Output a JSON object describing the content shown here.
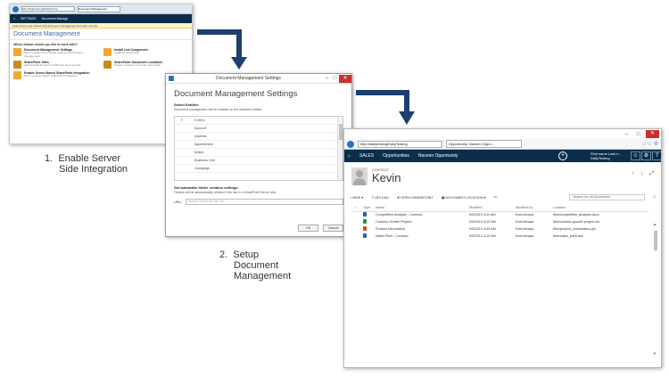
{
  "colors": {
    "arrow": "#1c3f6e",
    "crm_nav": "#0a2e4c",
    "close_red": "#c7302c",
    "title_blue": "#3a6ea5"
  },
  "captions": {
    "step1": {
      "number": "1.",
      "line1": "Enable Server",
      "line2": "Side Integration"
    },
    "step2": {
      "number": "2.",
      "line1": "Setup",
      "line2": "Document",
      "line3": "Management"
    }
  },
  "shot1": {
    "address": "http://dailytesting/DailyTesting",
    "tab": "Document Management",
    "nav": [
      "SETTINGS",
      "Document Manage"
    ],
    "notice": "Learn how to get started with document management and store records...",
    "title": "Document Management",
    "question": "Which feature would you like to work with?",
    "options": [
      {
        "title": "Document Management Settings",
        "desc": "Select entities and manage settings for document management."
      },
      {
        "title": "Install List Component",
        "desc": "Install list component"
      },
      {
        "title": "SharePoint Sites",
        "desc": "Add SharePoint sites to CRM and store records."
      },
      {
        "title": "SharePoint Document Locations",
        "desc": "Create a location record for each folder."
      },
      {
        "title": "Enable Server-Based SharePoint Integration",
        "desc": "Move to server-based SharePoint integration."
      }
    ]
  },
  "shot2": {
    "window_title": "Document Management Settings",
    "heading": "Document Management Settings",
    "select_label": "Select Entities",
    "select_desc": "Document management will be enabled on the selected entities.",
    "entities": [
      "Entities",
      "Account",
      "Address",
      "Appointment",
      "Article",
      "Business Unit",
      "Campaign"
    ],
    "folder_label": "Set automatic folder creation settings",
    "folder_desc": "Folders will be automatically created if the site is a SharePoint Server site.",
    "url_label": "URL:",
    "url_placeholder": "Specify SharePoint Site URL",
    "ok": "OK",
    "cancel": "Cancel"
  },
  "shot3": {
    "address": "http://dailytesting/DailyTesting",
    "tab": "Opportunity: Naveen Oppo...",
    "nav": [
      "SALES",
      "Opportunities",
      "Naveen Opportunity"
    ],
    "user": [
      "First name Last n...",
      "DailyTesting"
    ],
    "contact_type": "CONTACT",
    "contact_name": "Kevin",
    "commands": [
      "NEW",
      "UPLOAD",
      "OPEN SHAREPOINT",
      "DOCUMENT LOCATION",
      "•••"
    ],
    "search_placeholder": "Search for all documents",
    "columns": [
      "Type",
      "Name",
      "Modified",
      "Modified by",
      "Location"
    ],
    "rows": [
      {
        "name": "Competitive Analysis - Contoso",
        "modified": "9/3/2013 4:11 AM",
        "by": "Kobi Arcaya",
        "loc": "files/competitive_analysis.docx",
        "color": "#2b5faa"
      },
      {
        "name": "Contoso Growth Project",
        "modified": "9/3/2013 4:10 AM",
        "by": "Kobi Arcaya",
        "loc": "files/contoso-growth project.xls",
        "color": "#2e8b3e"
      },
      {
        "name": "Product Information",
        "modified": "9/3/2013 4:09 AM",
        "by": "Kobi Arcaya",
        "loc": "files/product_information.ppt",
        "color": "#c2502a"
      },
      {
        "name": "Sales Pitch - Contoso",
        "modified": "9/3/2013 4:10 AM",
        "by": "Kobi Arcaya",
        "loc": "files/sales_pitch.doc",
        "color": "#2b5faa"
      }
    ]
  }
}
